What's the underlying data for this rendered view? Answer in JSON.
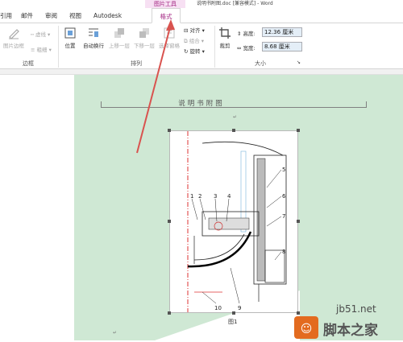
{
  "titlebar": {
    "context_group": "图片工具",
    "document_title": "说明书附图.doc [兼容模式] - Word"
  },
  "tabs": [
    {
      "label": "引用"
    },
    {
      "label": "邮件"
    },
    {
      "label": "审阅"
    },
    {
      "label": "视图"
    },
    {
      "label": "Autodesk Vault(K)"
    },
    {
      "label": "格式",
      "active": true
    }
  ],
  "ribbon": {
    "border_group": {
      "label": "边框",
      "picture_border": "图片边框",
      "dashes": "虚线",
      "weight": "粗细"
    },
    "arrange_group": {
      "label": "排列",
      "position": "位置",
      "wrap_text": "自动换行",
      "bring_forward": "上移一层",
      "send_backward": "下移一层",
      "selection_pane": "选择窗格",
      "align": "对齐",
      "group": "组合",
      "rotate": "旋转"
    },
    "size_group": {
      "label": "大小",
      "crop": "裁剪",
      "height_label": "高度:",
      "height_value": "12.36 厘米",
      "width_label": "宽度:",
      "width_value": "8.68 厘米"
    }
  },
  "document": {
    "header_text": "说明书附图",
    "caption": "图1",
    "labels": [
      "1",
      "2",
      "3",
      "4",
      "5",
      "6",
      "7",
      "8",
      "9",
      "10"
    ]
  },
  "watermark": {
    "site": "jb51.net",
    "name": "脚本之家"
  },
  "colors": {
    "context_tab": "#a0207f",
    "page_background": "#cfe8d4",
    "size_field": "#e4eef7",
    "annotation_arrow": "#d9534f"
  }
}
